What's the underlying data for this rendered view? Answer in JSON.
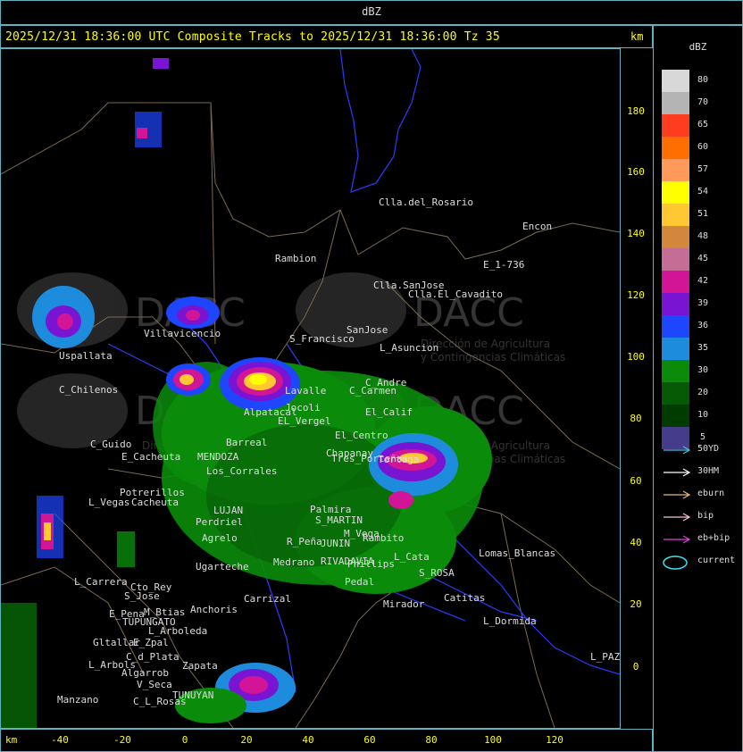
{
  "header": {
    "unit": "dBZ"
  },
  "title": {
    "text": "2025/12/31 18:36:00 UTC Composite Tracks to 2025/12/31 18:36:00 Tz 35",
    "km_label": "km"
  },
  "axes": {
    "y_ticks": [
      "180",
      "160",
      "140",
      "120",
      "100",
      "80",
      "60",
      "40",
      "20",
      "0"
    ],
    "x_ticks": [
      "-40",
      "-20",
      "0",
      "20",
      "40",
      "60",
      "80",
      "100",
      "120"
    ],
    "x_unit": "km"
  },
  "legend": {
    "title": "dBZ",
    "scale": [
      {
        "label": "80",
        "color": "#d8d8d8"
      },
      {
        "label": "70",
        "color": "#b4b4b4"
      },
      {
        "label": "65",
        "color": "#ff3c1e"
      },
      {
        "label": "60",
        "color": "#ff6e00"
      },
      {
        "label": "57",
        "color": "#ff9a5a"
      },
      {
        "label": "54",
        "color": "#ffff00"
      },
      {
        "label": "51",
        "color": "#ffc832"
      },
      {
        "label": "48",
        "color": "#d2873c"
      },
      {
        "label": "45",
        "color": "#c46e96"
      },
      {
        "label": "42",
        "color": "#d21496"
      },
      {
        "label": "39",
        "color": "#7814d2"
      },
      {
        "label": "36",
        "color": "#1e46ff"
      },
      {
        "label": "35",
        "color": "#1e8cdc"
      },
      {
        "label": "30",
        "color": "#0a8c0a"
      },
      {
        "label": "20",
        "color": "#065a06"
      },
      {
        "label": "10",
        "color": "#003c00"
      },
      {
        "label": "5",
        "color": "#463c8c"
      }
    ],
    "tracks": [
      {
        "label": "50YD",
        "color": "#40c8d8"
      },
      {
        "label": "30HM",
        "color": "#ffffff"
      },
      {
        "label": "eburn",
        "color": "#e8b870"
      },
      {
        "label": "bip",
        "color": "#ffc0d0"
      },
      {
        "label": "eb+bip",
        "color": "#e040e0"
      }
    ],
    "current_label": "current",
    "current_color": "#40e0f0"
  },
  "map": {
    "watermark_text": "DACC",
    "watermark_sub1": "Dirección de Agricultura",
    "watermark_sub2": "y Contingencias Climáticas",
    "places": [
      "Clla.del_Rosario",
      "Rambion",
      "Encon",
      "E_1-736",
      "Clla.SanJose",
      "Clla.El_Cavadito",
      "Villavicencio",
      "S_Francisco",
      "SanJose",
      "L_Asuncion",
      "Uspallata",
      "C_Andre",
      "C_Chilenos",
      "C_Carmen",
      "Lavalle",
      "El_Calif",
      "C_Guido",
      "El_Centro",
      "E_Cacheuta",
      "MENDOZA",
      "LUJAN",
      "Los_Corrales",
      "Barreal",
      "Potrerillos",
      "L_Vegas",
      "Cacheuta",
      "Perdriel",
      "Agrelo",
      "Ugarteche",
      "L_Carrera",
      "Cto_Rey",
      "S_Jose",
      "E_Pena",
      "TUPUNGATO",
      "Anchoris",
      "Carrizal",
      "M_Btias",
      "L_Arboleda",
      "Gltallar",
      "E_Zpal",
      "L_Arbols",
      "C_d_Plata",
      "Algarrob",
      "V_Seca",
      "Zapata",
      "Manzano",
      "TUNUYAN",
      "C_L_Rosas",
      "S_MARTIN",
      "RIVADAVIA",
      "JUNIN",
      "Phillips",
      "Rambito",
      "Medrano",
      "Lomas_Blancas",
      "S_ROSA",
      "Catitas",
      "L_Dormida",
      "L_PAZ",
      "Mirador",
      "Tres_Porteñas",
      "Chapanay",
      "Palmira",
      "R_Peña",
      "M_Vega",
      "L_Cata",
      "Pedal",
      "Tortuga",
      "EL_Vergel",
      "Jocoli",
      "Alpatacal"
    ]
  }
}
